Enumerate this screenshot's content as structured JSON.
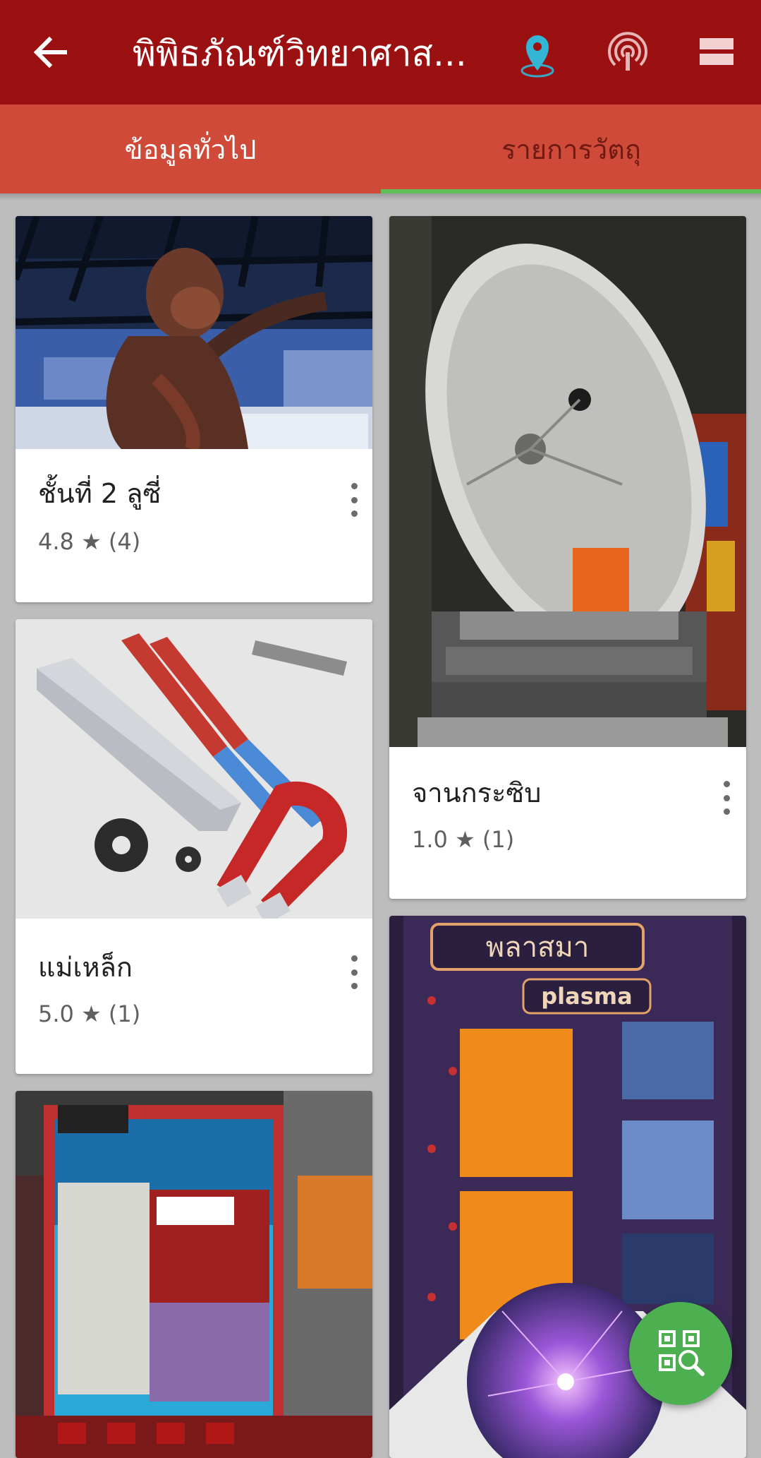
{
  "appbar": {
    "title": "พิพิธภัณฑ์วิทยาศาส...",
    "back_icon": "arrow-left-icon",
    "location_icon": "map-pin-icon",
    "nfc_icon": "nfc-signal-icon",
    "menu_icon": "list-view-icon"
  },
  "tabs": [
    {
      "label": "ข้อมูลทั่วไป",
      "selected": false
    },
    {
      "label": "รายการวัตถุ",
      "selected": true
    }
  ],
  "items": [
    {
      "name": "ชั้นที่ 2 ลูซี่",
      "rating": "4.8 ★ (4)",
      "image": "lucy-hominid-model-photo"
    },
    {
      "name": "จานกระซิบ",
      "rating": "1.0 ★ (1)",
      "image": "whispering-dish-photo"
    },
    {
      "name": "แม่เหล็ก",
      "rating": "5.0 ★ (1)",
      "image": "magnets-photo"
    },
    {
      "name": "",
      "rating": "",
      "image": "electricity-exhibit-photo"
    },
    {
      "name": "",
      "rating": "",
      "image": "plasma-exhibit-photo",
      "sign_text": [
        "พลาสมา",
        "plasma"
      ]
    }
  ],
  "fab": {
    "icon": "qr-scan-icon"
  },
  "colors": {
    "appbar": "#9b1111",
    "tabbar": "#cf4a38",
    "tab_indicator": "#5fbf54",
    "fab": "#4caf50",
    "background": "#bdbdbd"
  }
}
